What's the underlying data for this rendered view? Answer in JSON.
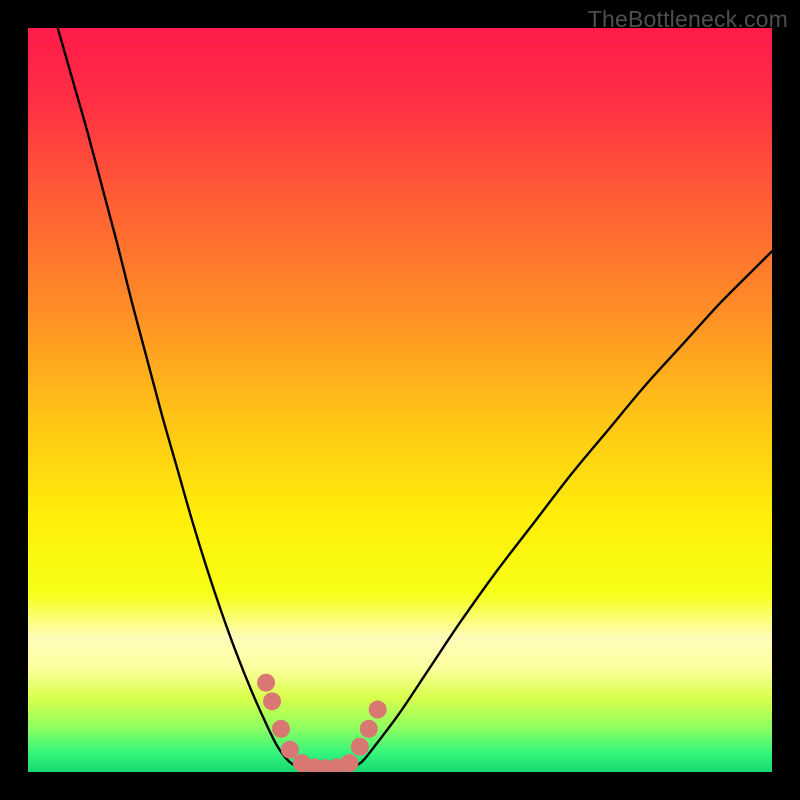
{
  "watermark": "TheBottleneck.com",
  "gradient": {
    "stops": [
      {
        "offset": 0.0,
        "color": "#ff1b4a"
      },
      {
        "offset": 0.1,
        "color": "#ff2f44"
      },
      {
        "offset": 0.22,
        "color": "#ff5a36"
      },
      {
        "offset": 0.38,
        "color": "#ff8e26"
      },
      {
        "offset": 0.52,
        "color": "#ffc317"
      },
      {
        "offset": 0.66,
        "color": "#ffef09"
      },
      {
        "offset": 0.76,
        "color": "#f6ff17"
      },
      {
        "offset": 0.82,
        "color": "#fffcbb"
      },
      {
        "offset": 0.86,
        "color": "#fdffa0"
      },
      {
        "offset": 0.9,
        "color": "#d9ff4b"
      },
      {
        "offset": 0.94,
        "color": "#8fff60"
      },
      {
        "offset": 0.975,
        "color": "#33f57c"
      },
      {
        "offset": 1.0,
        "color": "#17d86f"
      }
    ]
  },
  "chart_data": {
    "type": "line",
    "title": "",
    "xlabel": "",
    "ylabel": "",
    "xlim": [
      0,
      100
    ],
    "ylim": [
      0,
      100
    ],
    "series": [
      {
        "name": "left-branch",
        "x": [
          4,
          6,
          8,
          10,
          12,
          14,
          16,
          18,
          20,
          22,
          24,
          26,
          28,
          30,
          32,
          33.5,
          35,
          36.5
        ],
        "y": [
          100,
          93,
          86,
          78.5,
          71,
          63,
          55.5,
          48,
          41,
          34,
          27.5,
          21.5,
          16,
          11,
          6.5,
          3.5,
          1.5,
          0.5
        ]
      },
      {
        "name": "right-branch",
        "x": [
          43.5,
          45,
          47,
          50,
          54,
          58,
          63,
          68,
          73,
          78,
          83,
          88,
          93,
          98,
          100
        ],
        "y": [
          0.5,
          1.5,
          4,
          8,
          14,
          20,
          27,
          33.5,
          40,
          46,
          52,
          57.5,
          63,
          68,
          70
        ]
      },
      {
        "name": "valley-floor",
        "x": [
          36.5,
          38,
          40,
          42,
          43.5
        ],
        "y": [
          0.5,
          0.2,
          0.2,
          0.2,
          0.5
        ]
      }
    ],
    "markers": [
      {
        "name": "left-marker-1",
        "x": 32.0,
        "y": 12.0
      },
      {
        "name": "left-marker-2",
        "x": 32.8,
        "y": 9.5
      },
      {
        "name": "left-marker-3",
        "x": 34.0,
        "y": 5.8
      },
      {
        "name": "left-marker-4",
        "x": 35.2,
        "y": 3.0
      },
      {
        "name": "left-marker-5",
        "x": 36.8,
        "y": 1.2
      },
      {
        "name": "floor-marker-1",
        "x": 38.5,
        "y": 0.6
      },
      {
        "name": "floor-marker-2",
        "x": 40.0,
        "y": 0.5
      },
      {
        "name": "floor-marker-3",
        "x": 41.5,
        "y": 0.6
      },
      {
        "name": "right-marker-1",
        "x": 43.2,
        "y": 1.2
      },
      {
        "name": "right-marker-2",
        "x": 44.6,
        "y": 3.4
      },
      {
        "name": "right-marker-3",
        "x": 45.8,
        "y": 5.8
      },
      {
        "name": "right-marker-4",
        "x": 47.0,
        "y": 8.4
      }
    ],
    "marker_style": {
      "fill": "#d97772",
      "radius_px": 9
    }
  }
}
